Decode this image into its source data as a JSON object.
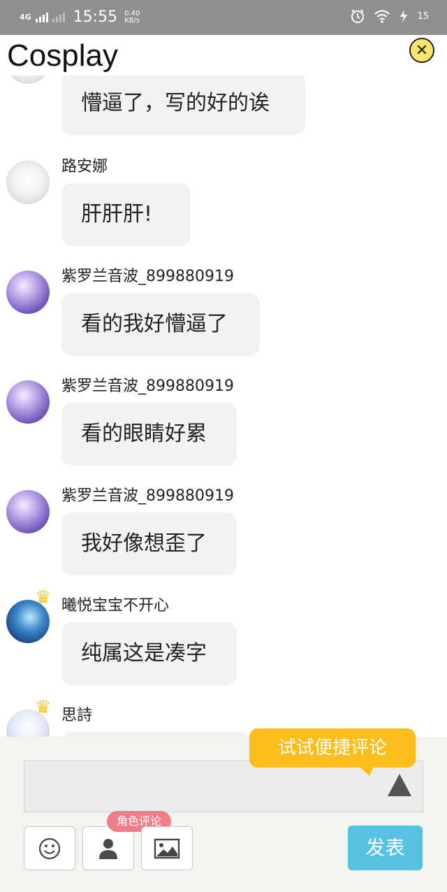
{
  "status_bar": {
    "network": "4G",
    "time": "15:55",
    "speed_value": "0.40",
    "speed_unit": "KB/s",
    "battery": "15",
    "icons": [
      "signal-icon",
      "alarm-icon",
      "wifi-icon",
      "charging-icon"
    ]
  },
  "header": {
    "title": "Cosplay",
    "close_icon": "close-icon"
  },
  "comments": [
    {
      "username": "",
      "text": "懵逼了，写的好的诶",
      "avatar": "gray"
    },
    {
      "username": "路安娜",
      "text": "肝肝肝!",
      "avatar": "gray"
    },
    {
      "username": "紫罗兰音波_899880919",
      "text": "看的我好懵逼了",
      "avatar": "violet"
    },
    {
      "username": "紫罗兰音波_899880919",
      "text": "看的眼睛好累",
      "avatar": "violet"
    },
    {
      "username": "紫罗兰音波_899880919",
      "text": "我好像想歪了",
      "avatar": "violet"
    },
    {
      "username": "曦悦宝宝不开心",
      "text": "纯属这是凑字",
      "avatar": "blue",
      "crown": true
    },
    {
      "username": "思詩",
      "text": "",
      "avatar": "pale",
      "crown": true
    }
  ],
  "composer": {
    "input_value": "",
    "hint_text": "试试便捷评论",
    "role_tag": "角色评论",
    "send_label": "发表",
    "tools": [
      "emoji-icon",
      "person-icon",
      "image-icon"
    ]
  },
  "colors": {
    "accent_yellow": "#fbbd1a",
    "send_blue": "#56c1e0",
    "role_pink": "#ef7e8a",
    "bubble_gray": "#f2f2f2"
  }
}
